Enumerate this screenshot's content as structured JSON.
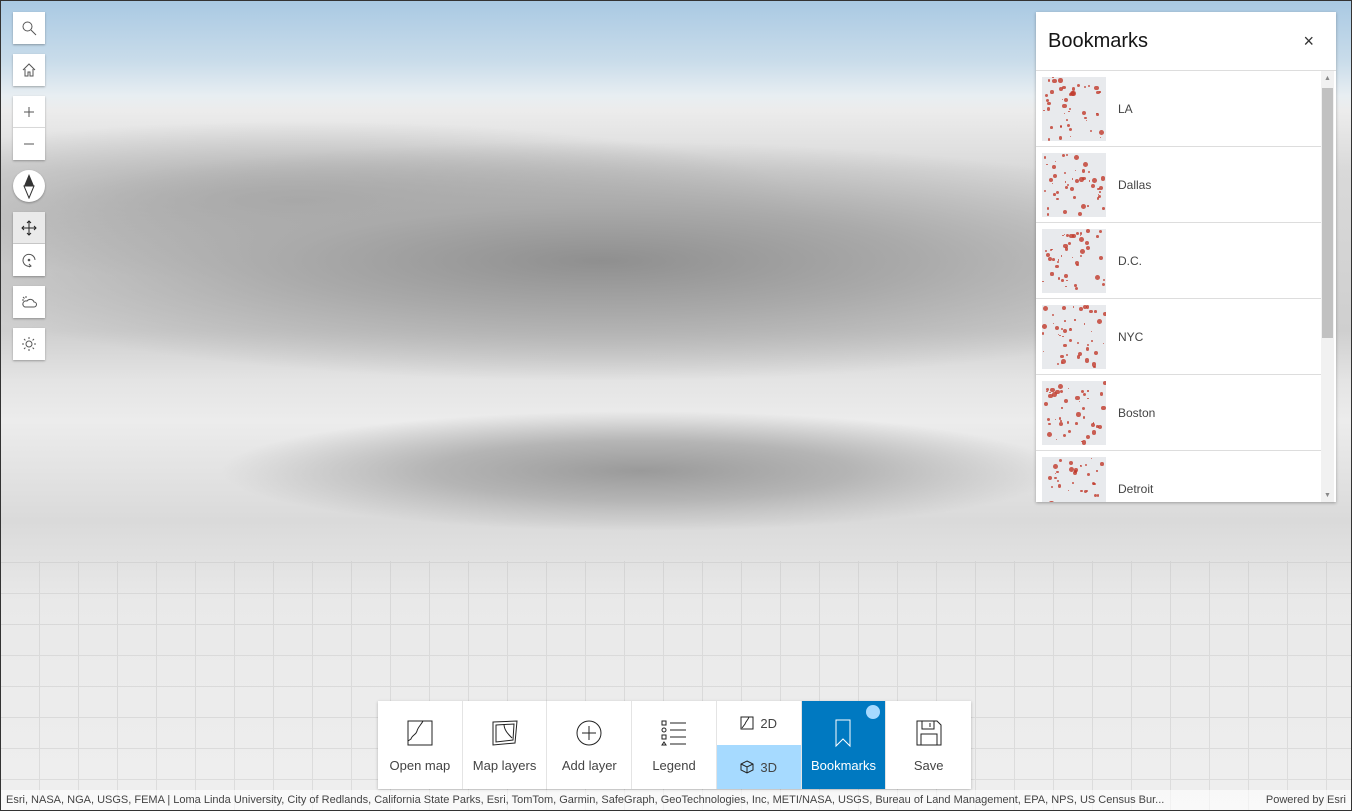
{
  "panel": {
    "title": "Bookmarks",
    "close_label": "×",
    "bookmarks": [
      {
        "label": "LA"
      },
      {
        "label": "Dallas"
      },
      {
        "label": "D.C."
      },
      {
        "label": "NYC"
      },
      {
        "label": "Boston"
      },
      {
        "label": "Detroit"
      }
    ]
  },
  "toolbar": {
    "open_map": "Open map",
    "map_layers": "Map layers",
    "add_layer": "Add layer",
    "legend": "Legend",
    "mode_2d": "2D",
    "mode_3d": "3D",
    "bookmarks": "Bookmarks",
    "save": "Save"
  },
  "attribution": {
    "text": "Esri, NASA, NGA, USGS, FEMA | Loma Linda University, City of Redlands, California State Parks, Esri, TomTom, Garmin, SafeGraph, GeoTechnologies, Inc, METI/NASA, USGS, Bureau of Land Management, EPA, NPS, US Census Bur...",
    "powered": "Powered by Esri"
  },
  "colors": {
    "accent": "#0079c1",
    "selected": "#a6daff",
    "dots": "#c0392b"
  }
}
